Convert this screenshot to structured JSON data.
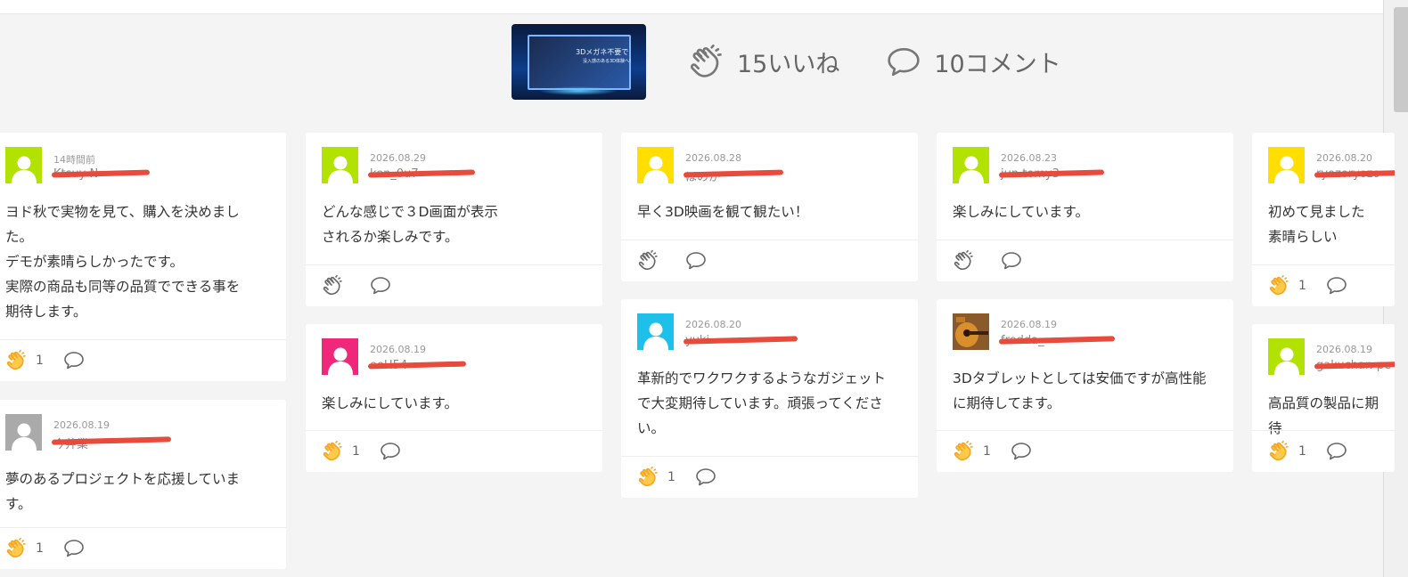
{
  "header": {
    "thumbnail": {
      "title": "3Dメガネ不要で",
      "subtitle": "没入感のある3D体験へ!"
    },
    "likes_label": "15いいね",
    "comments_label": "10コメント"
  },
  "colors": {
    "clap_active": "#f5a623",
    "clap_inactive": "#777777",
    "redaction": "#e84a3c"
  },
  "comments": [
    {
      "date": "14時間前",
      "name": "Ktsuy N",
      "avatar": "lime",
      "text": "ヨド秋で実物を見て、購入を決めました。\nデモが素晴らしかったです。\n実際の商品も同等の品質でできる事を期待します。",
      "likes": "1"
    },
    {
      "date": "2026.08.19",
      "name": "今井業",
      "avatar": "gray",
      "text": "夢のあるプロジェクトを応援しています。",
      "likes": "1"
    },
    {
      "date": "2026.08.29",
      "name": "ken_0u7",
      "avatar": "lime",
      "text": "どんな感じで３D画面が表示されるか楽しみです。",
      "likes": ""
    },
    {
      "date": "2026.08.19",
      "name": "ooH54",
      "avatar": "pink",
      "text": "楽しみにしています。",
      "likes": "1"
    },
    {
      "date": "2026.08.28",
      "name": "ほのか",
      "avatar": "yellow",
      "text": "早く3D映画を観て観たい！",
      "likes": ""
    },
    {
      "date": "2026.08.20",
      "name": "yuki",
      "avatar": "cyan",
      "text": "革新的でワクワクするようなガジェットで大変期待しています。頑張ってください。",
      "likes": "1"
    },
    {
      "date": "2026.08.23",
      "name": "jun.tomy3",
      "avatar": "lime",
      "text": "楽しみにしています。",
      "likes": ""
    },
    {
      "date": "2026.08.19",
      "name": "fredda_",
      "avatar": "guitar",
      "text": "3Dタブレットとしては安価ですが高性能に期待してます。",
      "likes": "1"
    },
    {
      "date": "2026.08.20",
      "name": "ryozoryozo",
      "avatar": "yellow",
      "text": "初めて見ました\n素晴らしい",
      "likes": "1"
    },
    {
      "date": "2026.08.19",
      "name": "gakuchan-pe",
      "avatar": "lime",
      "text": "高品質の製品に期待",
      "likes": "1"
    }
  ]
}
